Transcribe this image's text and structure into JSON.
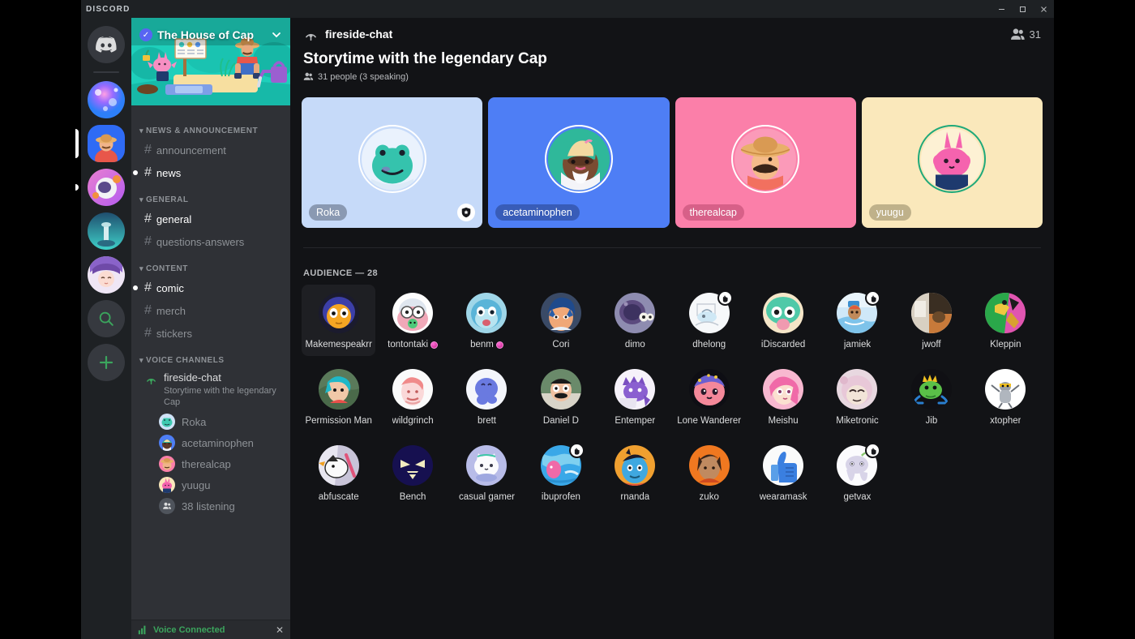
{
  "window": {
    "wordmark": "DISCORD",
    "minimize": "–",
    "maximize": "☐",
    "close": "✕"
  },
  "server_rail": {
    "home_icon": "discord-logo-icon",
    "servers": [
      {
        "name": "server-nebula",
        "state": "idle"
      },
      {
        "name": "the-house-of-cap",
        "state": "active"
      },
      {
        "name": "server-astronaut",
        "state": "unread"
      },
      {
        "name": "server-tower",
        "state": "idle"
      },
      {
        "name": "server-anime",
        "state": "idle"
      }
    ],
    "search_label": "search-icon",
    "add_label": "add-server-icon"
  },
  "sidebar": {
    "server_name": "The House of Cap",
    "verified_glyph": "✓",
    "chevron_glyph": "⌄",
    "categories": [
      {
        "label": "NEWS & ANNOUNCEMENT",
        "channels": [
          {
            "name": "announcement",
            "state": "muted",
            "unread": false
          },
          {
            "name": "news",
            "state": "unread",
            "unread": true
          }
        ]
      },
      {
        "label": "GENERAL",
        "channels": [
          {
            "name": "general",
            "state": "read",
            "unread": false
          },
          {
            "name": "questions-answers",
            "state": "muted",
            "unread": false
          }
        ]
      },
      {
        "label": "CONTENT",
        "channels": [
          {
            "name": "comic",
            "state": "unread",
            "unread": true
          },
          {
            "name": "merch",
            "state": "muted",
            "unread": false
          },
          {
            "name": "stickers",
            "state": "muted",
            "unread": false
          }
        ]
      }
    ],
    "voice_category": "VOICE CHANNELS",
    "voice_channel": {
      "name": "fireside-chat",
      "topic": "Storytime with the legendary Cap",
      "members": [
        {
          "name": "Roka",
          "avatar": "frog"
        },
        {
          "name": "acetaminophen",
          "avatar": "wizard"
        },
        {
          "name": "therealcap",
          "avatar": "cap"
        },
        {
          "name": "yuugu",
          "avatar": "bunny"
        }
      ],
      "listening_label": "38 listening"
    },
    "voice_status": {
      "label": "Voice Connected",
      "disconnect_glyph": "✕"
    }
  },
  "main": {
    "channel_icon": "stage-channel-icon",
    "channel_name": "fireside-chat",
    "members_icon": "people-icon",
    "members_count": "31",
    "stage_title": "Storytime with the legendary Cap",
    "stage_people": "31 people (3 speaking)",
    "speakers": [
      {
        "name": "Roka",
        "avatar": "frog",
        "bg": "#c6daf9",
        "pill_bg": "rgba(90,100,120,0.55)",
        "moderator": true,
        "ring": "#ffffff"
      },
      {
        "name": "acetaminophen",
        "avatar": "wizard",
        "bg": "#4e7ef5",
        "pill_bg": "rgba(30,50,110,0.45)",
        "moderator": false,
        "ring": "#ffffff"
      },
      {
        "name": "therealcap",
        "avatar": "cap",
        "bg": "#fb7fa9",
        "pill_bg": "rgba(170,60,95,0.45)",
        "moderator": false,
        "ring": "#ffffff"
      },
      {
        "name": "yuugu",
        "avatar": "bunny",
        "bg": "#fae8bb",
        "pill_bg": "rgba(120,110,80,0.45)",
        "moderator": false,
        "ring": "#1fa97a"
      }
    ],
    "audience_header": "AUDIENCE — 28",
    "audience": [
      {
        "name": "Makemespeakrr",
        "avatar": "makemespeakrr",
        "hand": false,
        "nitro": false,
        "hovered": true
      },
      {
        "name": "tontontaki",
        "avatar": "tontontaki",
        "hand": false,
        "nitro": true,
        "hovered": false
      },
      {
        "name": "benm",
        "avatar": "benm",
        "hand": false,
        "nitro": true,
        "hovered": false
      },
      {
        "name": "Cori",
        "avatar": "cori",
        "hand": false,
        "nitro": false,
        "hovered": false
      },
      {
        "name": "dimo",
        "avatar": "dimo",
        "hand": false,
        "nitro": false,
        "hovered": false
      },
      {
        "name": "dhelong",
        "avatar": "dhelong",
        "hand": true,
        "nitro": false,
        "hovered": false
      },
      {
        "name": "iDiscarded",
        "avatar": "idiscarded",
        "hand": false,
        "nitro": false,
        "hovered": false
      },
      {
        "name": "jamiek",
        "avatar": "jamiek",
        "hand": true,
        "nitro": false,
        "hovered": false
      },
      {
        "name": "jwoff",
        "avatar": "jwoff",
        "hand": false,
        "nitro": false,
        "hovered": false
      },
      {
        "name": "Kleppin",
        "avatar": "kleppin",
        "hand": false,
        "nitro": false,
        "hovered": false
      },
      {
        "name": "Permission Man",
        "avatar": "permissionman",
        "hand": false,
        "nitro": false,
        "hovered": false
      },
      {
        "name": "wildgrinch",
        "avatar": "wildgrinch",
        "hand": false,
        "nitro": false,
        "hovered": false
      },
      {
        "name": "brett",
        "avatar": "brett",
        "hand": false,
        "nitro": false,
        "hovered": false
      },
      {
        "name": "Daniel D",
        "avatar": "danield",
        "hand": false,
        "nitro": false,
        "hovered": false
      },
      {
        "name": "Entemper",
        "avatar": "entemper",
        "hand": false,
        "nitro": false,
        "hovered": false
      },
      {
        "name": "Lone Wanderer",
        "avatar": "lonewanderer",
        "hand": false,
        "nitro": false,
        "hovered": false
      },
      {
        "name": "Meishu",
        "avatar": "meishu",
        "hand": false,
        "nitro": false,
        "hovered": false
      },
      {
        "name": "Miketronic",
        "avatar": "miketronic",
        "hand": false,
        "nitro": false,
        "hovered": false
      },
      {
        "name": "Jib",
        "avatar": "jib",
        "hand": false,
        "nitro": false,
        "hovered": false
      },
      {
        "name": "xtopher",
        "avatar": "xtopher",
        "hand": false,
        "nitro": false,
        "hovered": false
      },
      {
        "name": "abfuscate",
        "avatar": "abfuscate",
        "hand": false,
        "nitro": false,
        "hovered": false
      },
      {
        "name": "Bench",
        "avatar": "bench",
        "hand": false,
        "nitro": false,
        "hovered": false
      },
      {
        "name": "casual gamer",
        "avatar": "casualgamer",
        "hand": false,
        "nitro": false,
        "hovered": false
      },
      {
        "name": "ibuprofen",
        "avatar": "ibuprofen",
        "hand": true,
        "nitro": false,
        "hovered": false
      },
      {
        "name": "rnanda",
        "avatar": "rnanda",
        "hand": false,
        "nitro": false,
        "hovered": false
      },
      {
        "name": "zuko",
        "avatar": "zuko",
        "hand": false,
        "nitro": false,
        "hovered": false
      },
      {
        "name": "wearamask",
        "avatar": "wearamask",
        "hand": false,
        "nitro": false,
        "hovered": false
      },
      {
        "name": "getvax",
        "avatar": "getvax",
        "hand": true,
        "nitro": false,
        "hovered": false
      }
    ]
  },
  "colors": {
    "app_bg": "#121316",
    "sidebar_bg": "#2f3136",
    "rail_bg": "#1e2124",
    "accent_green": "#3ba55d",
    "brand": "#5865f2"
  }
}
